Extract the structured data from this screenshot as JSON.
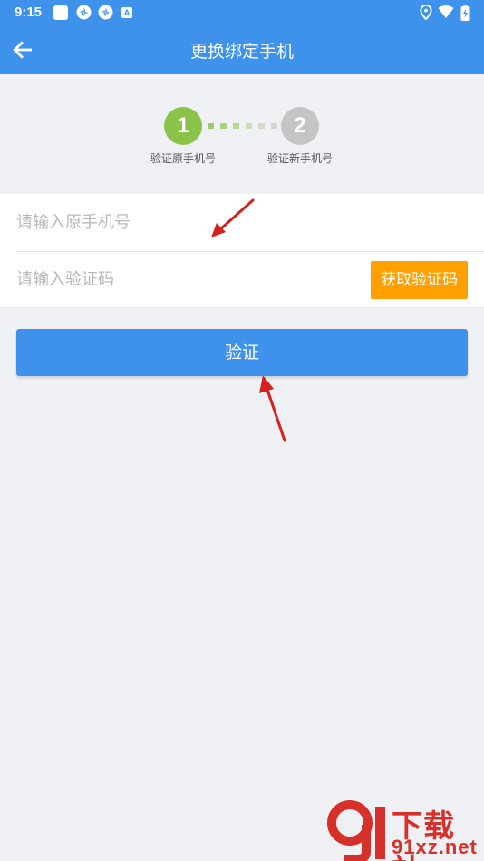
{
  "status_bar": {
    "time": "9:15",
    "icons": [
      "app-square-icon",
      "app-pinwheel-icon",
      "app-pinwheel-icon",
      "font-a-icon",
      "location-icon",
      "wifi-icon",
      "battery-charging-icon"
    ],
    "font_icon_letter": "A"
  },
  "header": {
    "title": "更换绑定手机",
    "back_icon": "arrow-left-icon"
  },
  "steps": [
    {
      "number": "1",
      "label": "验证原手机号",
      "state": "active",
      "color": "#8bc34a"
    },
    {
      "number": "2",
      "label": "验证新手机号",
      "state": "inactive",
      "color": "#c5c5c7"
    }
  ],
  "form": {
    "phone_placeholder": "请输入原手机号",
    "phone_value": "",
    "code_placeholder": "请输入验证码",
    "code_value": "",
    "get_code_label": "获取验证码"
  },
  "verify_button_label": "验证",
  "watermark": {
    "text": "下载站",
    "domain": "91xz.net"
  },
  "colors": {
    "primary": "#3e92ec",
    "accent": "#ff9f00",
    "step_active": "#8bc34a",
    "step_inactive": "#c5c5c7",
    "background": "#eff0f4",
    "annotation_arrow": "#d62020"
  }
}
